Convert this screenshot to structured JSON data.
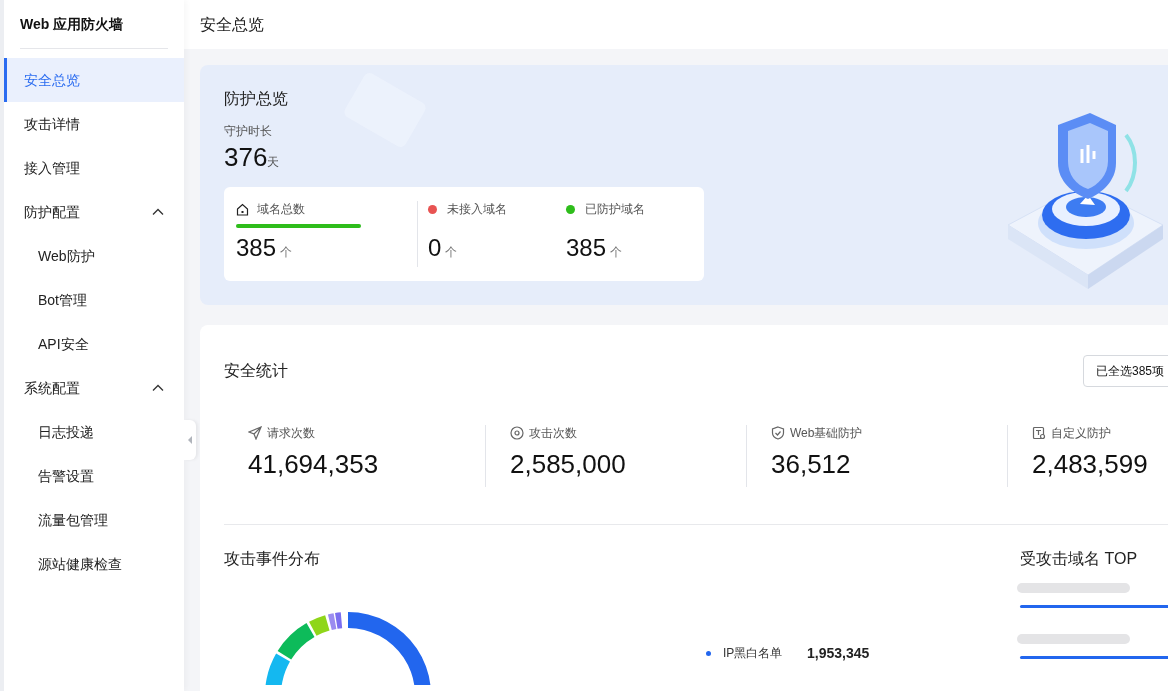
{
  "sidebar": {
    "title": "Web 应用防火墙",
    "items": [
      {
        "kind": "item",
        "label": "安全总览",
        "selected": true
      },
      {
        "kind": "item",
        "label": "攻击详情",
        "selected": false
      },
      {
        "kind": "item",
        "label": "接入管理",
        "selected": false
      },
      {
        "kind": "group",
        "label": "防护配置",
        "selected": false,
        "expanded": true,
        "children": [
          {
            "kind": "item",
            "label": "Web防护",
            "selected": false
          },
          {
            "kind": "item",
            "label": "Bot管理",
            "selected": false
          },
          {
            "kind": "item",
            "label": "API安全",
            "selected": false
          }
        ]
      },
      {
        "kind": "group",
        "label": "系统配置",
        "selected": false,
        "expanded": true,
        "children": [
          {
            "kind": "item",
            "label": "日志投递",
            "selected": false
          },
          {
            "kind": "item",
            "label": "告警设置",
            "selected": false
          },
          {
            "kind": "item",
            "label": "流量包管理",
            "selected": false
          },
          {
            "kind": "item",
            "label": "源站健康检查",
            "selected": false
          }
        ]
      }
    ]
  },
  "header": {
    "title": "安全总览"
  },
  "overview": {
    "title": "防护总览",
    "duration_label": "守护时长",
    "duration_value": "376",
    "duration_unit": "天",
    "domains": [
      {
        "kind": "total",
        "label": "域名总数",
        "value": "385",
        "unit": "个",
        "level": 1,
        "color": "#2ebd1b"
      },
      {
        "kind": "dot",
        "label": "未接入域名",
        "value": "0",
        "unit": "个",
        "color": "#e85352"
      },
      {
        "kind": "dot",
        "label": "已防护域名",
        "value": "385",
        "unit": "个",
        "color": "#2ebd1b"
      }
    ]
  },
  "stats": {
    "title": "安全统计",
    "select_button": "已全选385项",
    "items": [
      {
        "kind": "request",
        "label": "请求次数",
        "value": "41,694,353"
      },
      {
        "kind": "attack",
        "label": "攻击次数",
        "value": "2,585,000"
      },
      {
        "kind": "web",
        "label": "Web基础防护",
        "value": "36,512"
      },
      {
        "kind": "custom",
        "label": "自定义防护",
        "value": "2,483,599"
      }
    ]
  },
  "distribution": {
    "title": "攻击事件分布",
    "legend": [
      {
        "label": "IP黑白名单",
        "value": "1,953,345",
        "color": "#2266ee"
      }
    ]
  },
  "top_domains": {
    "title": "受攻击域名 TOP",
    "rows": [
      {
        "level": 1
      },
      {
        "level": 1
      }
    ]
  }
}
